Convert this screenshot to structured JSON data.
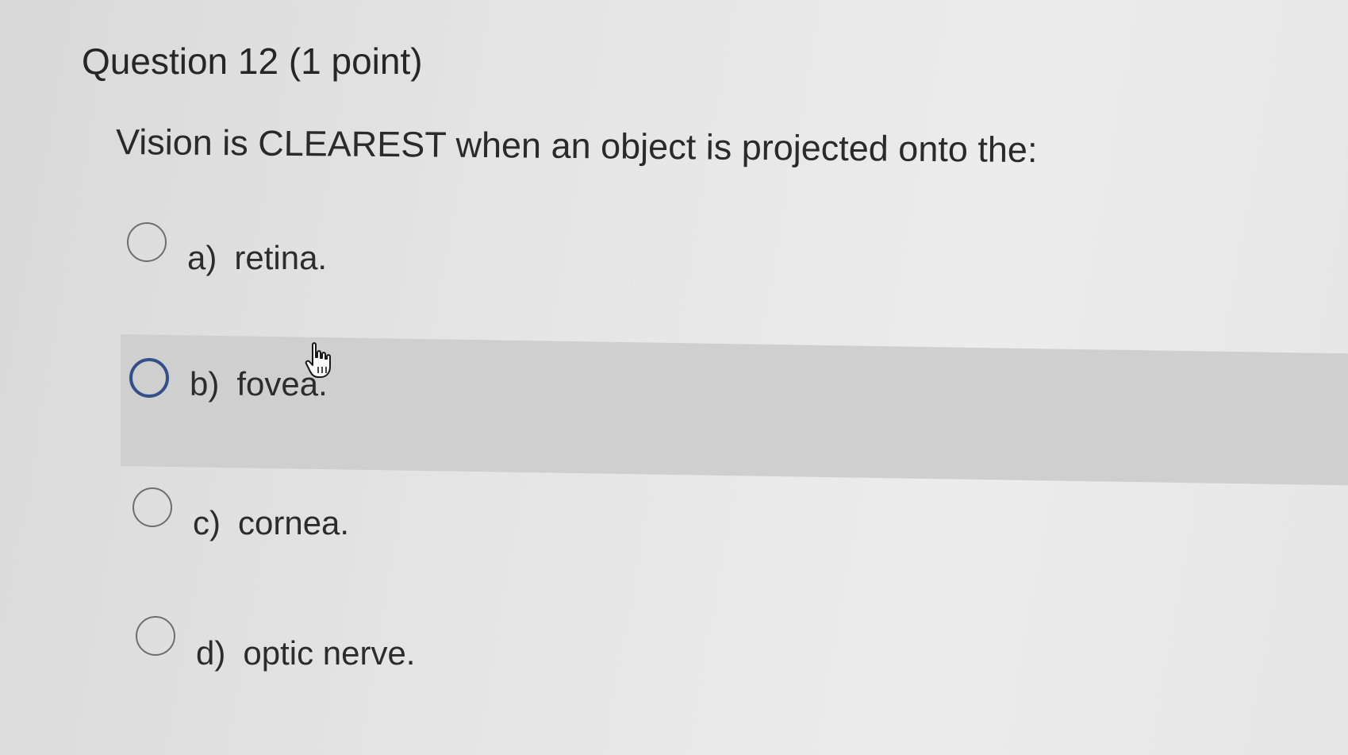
{
  "question": {
    "title": "Question 12 (1 point)",
    "prompt": "Vision is CLEAREST when an object is projected onto the:"
  },
  "options": [
    {
      "letter": "a)",
      "text": "retina."
    },
    {
      "letter": "b)",
      "text": "fovea."
    },
    {
      "letter": "c)",
      "text": "cornea."
    },
    {
      "letter": "d)",
      "text": "optic nerve."
    }
  ],
  "state": {
    "hovered_option": "b)",
    "focused_option": "b)"
  },
  "colors": {
    "focus_ring": "#34508a",
    "hover_band": "#cfcfcf",
    "background": "#e4e4e4"
  },
  "icons": {
    "cursor": "hand-pointer-icon"
  }
}
